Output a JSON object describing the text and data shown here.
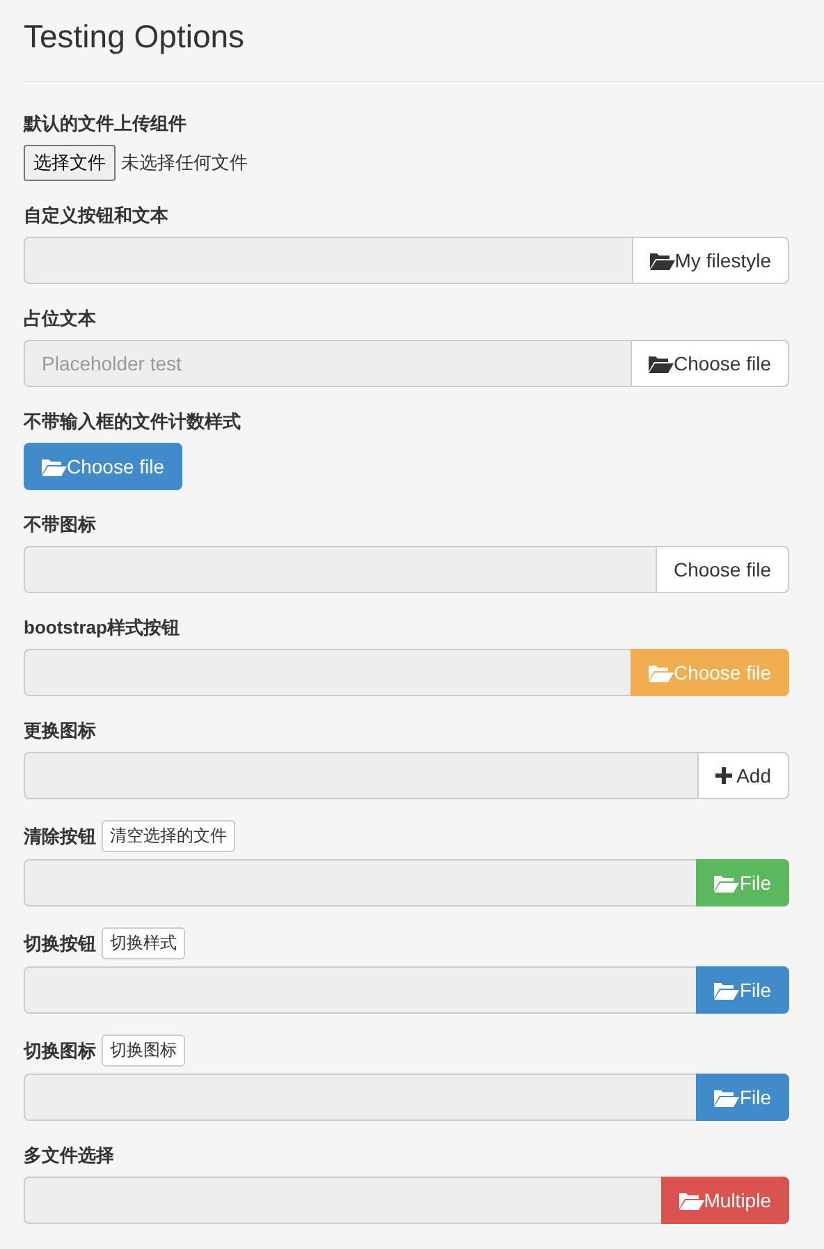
{
  "title": "Testing Options",
  "sections": [
    {
      "label": "默认的文件上传组件",
      "kind": "native",
      "button": "选择文件",
      "status": "未选择任何文件"
    },
    {
      "label": "自定义按钮和文本",
      "kind": "group",
      "button": "My filestyle",
      "color": "#ffffff"
    },
    {
      "label": "占位文本",
      "kind": "group",
      "placeholder": "Placeholder test",
      "button": "Choose file",
      "color": "#ffffff"
    },
    {
      "label": "不带输入框的文件计数样式",
      "kind": "button",
      "button": "Choose file",
      "color": "#428bca"
    },
    {
      "label": "不带图标",
      "kind": "group",
      "button": "Choose file",
      "color": "#ffffff"
    },
    {
      "label": "bootstrap样式按钮",
      "kind": "group",
      "button": "Choose file",
      "color": "#f0ad4e"
    },
    {
      "label": "更换图标",
      "kind": "group",
      "button": "Add",
      "color": "#ffffff"
    },
    {
      "label": "清除按钮",
      "action": "清空选择的文件",
      "kind": "group",
      "button": "File",
      "color": "#5cb85c"
    },
    {
      "label": "切换按钮",
      "action": "切换样式",
      "kind": "group",
      "button": "File",
      "color": "#428bca"
    },
    {
      "label": "切换图标",
      "action": "切换图标",
      "kind": "group",
      "button": "File",
      "color": "#428bca"
    },
    {
      "label": "多文件选择",
      "kind": "group",
      "button": "Multiple",
      "color": "#d9534f"
    }
  ]
}
